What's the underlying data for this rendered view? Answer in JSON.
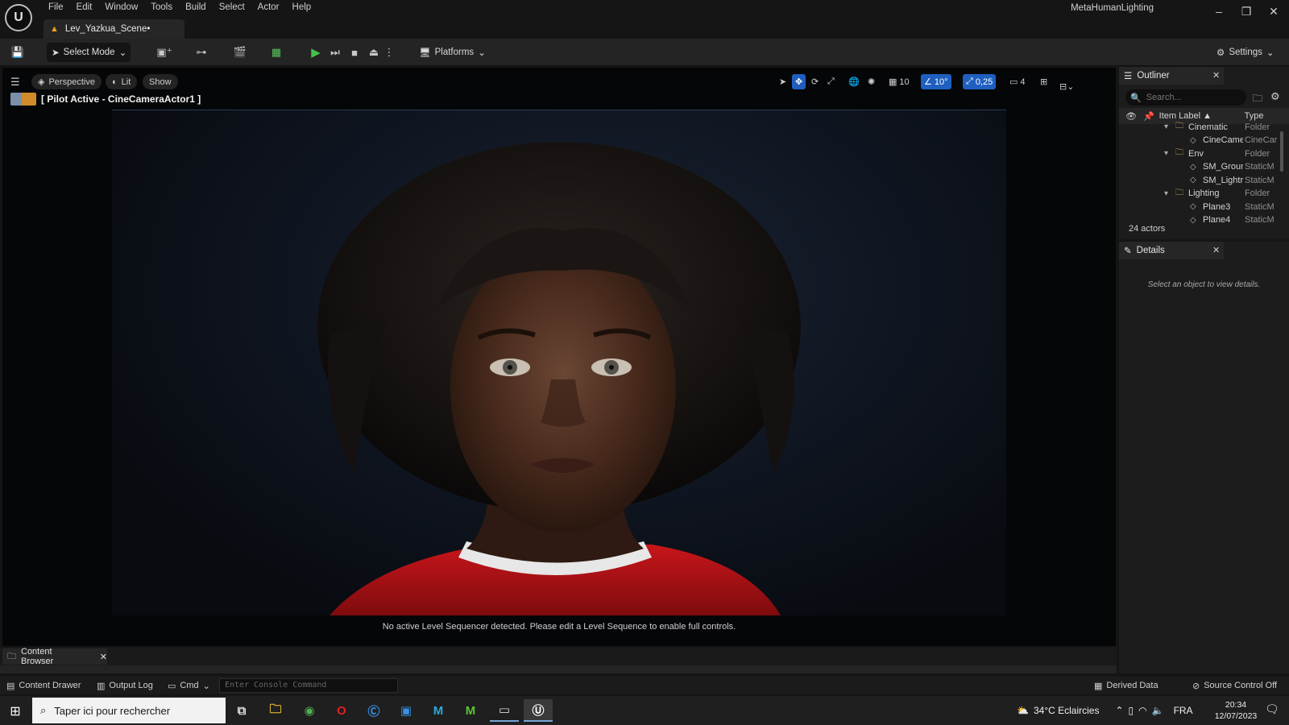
{
  "titlebar": {
    "menus": [
      "File",
      "Edit",
      "Window",
      "Tools",
      "Build",
      "Select",
      "Actor",
      "Help"
    ],
    "doc_tab": "Lev_Yazkua_Scene•",
    "project_name": "MetaHumanLighting"
  },
  "toolbar": {
    "select_mode": "Select Mode",
    "platforms": "Platforms",
    "settings": "Settings"
  },
  "viewport": {
    "perspective": "Perspective",
    "lit": "Lit",
    "show": "Show",
    "pilot_label": "[ Pilot Active - CineCameraActor1 ]",
    "grid_snap": "10",
    "rotation_snap": "10°",
    "scale_snap": "0,25",
    "camera_speed": "4",
    "sequencer_message": "No active Level Sequencer detected. Please edit a Level Sequence to enable full controls."
  },
  "outliner": {
    "title": "Outliner",
    "search_placeholder": "Search...",
    "col_label": "Item Label ▲",
    "col_type": "Type",
    "rows": [
      {
        "label": "Cinematic",
        "type": "Folder",
        "kind": "folder",
        "indent": 1
      },
      {
        "label": "CineCamer",
        "type": "CineCar",
        "kind": "actor",
        "indent": 2
      },
      {
        "label": "Env",
        "type": "Folder",
        "kind": "folder",
        "indent": 1
      },
      {
        "label": "SM_Groun",
        "type": "StaticM",
        "kind": "actor",
        "indent": 2
      },
      {
        "label": "SM_Lightrc",
        "type": "StaticM",
        "kind": "actor",
        "indent": 2
      },
      {
        "label": "Lighting",
        "type": "Folder",
        "kind": "folder",
        "indent": 1
      },
      {
        "label": "Plane3",
        "type": "StaticM",
        "kind": "actor",
        "indent": 2
      },
      {
        "label": "Plane4",
        "type": "StaticM",
        "kind": "actor",
        "indent": 2
      }
    ],
    "actor_count": "24 actors"
  },
  "details": {
    "title": "Details",
    "empty_message": "Select an object to view details."
  },
  "content_browser": {
    "tab": "Content Browser"
  },
  "statusbar": {
    "content_drawer": "Content Drawer",
    "output_log": "Output Log",
    "cmd": "Cmd",
    "console_placeholder": "Enter Console Command",
    "derived_data": "Derived Data",
    "source_control": "Source Control Off"
  },
  "taskbar": {
    "search_placeholder": "Taper ici pour rechercher",
    "weather": "34°C  Eclaircies",
    "language": "FRA",
    "time": "20:34",
    "date": "12/07/2023"
  },
  "colors": {
    "accent_blue": "#1e5fbf",
    "play_green": "#47c14a",
    "shirt_red": "#c8161a"
  }
}
